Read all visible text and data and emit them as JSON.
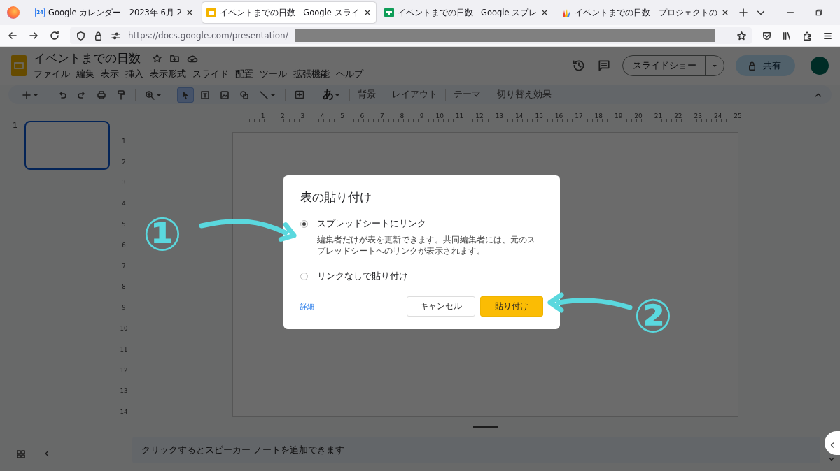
{
  "browser": {
    "tabs": [
      {
        "label": "Google カレンダー - 2023年 6月 2",
        "kind": "calendar",
        "icon_text": "24",
        "selected": false
      },
      {
        "label": "イベントまでの日数 - Google スライ",
        "kind": "slides",
        "selected": true
      },
      {
        "label": "イベントまでの日数 - Google スプレ",
        "kind": "sheets",
        "selected": false
      },
      {
        "label": "イベントまでの日数 - プロジェクトの",
        "kind": "project",
        "selected": false
      }
    ],
    "url": "https://docs.google.com/presentation/"
  },
  "document": {
    "title": "イベントまでの日数",
    "menu": [
      "ファイル",
      "編集",
      "表示",
      "挿入",
      "表示形式",
      "スライド",
      "配置",
      "ツール",
      "拡張機能",
      "ヘルプ"
    ],
    "slideshow_label": "スライドショー",
    "share_label": "共有"
  },
  "toolbar": {
    "tools": [
      {
        "kind": "add",
        "selected": false
      },
      {
        "kind": "undo",
        "selected": false
      },
      {
        "kind": "redo",
        "selected": false
      },
      {
        "kind": "print",
        "selected": false
      },
      {
        "kind": "paint",
        "selected": false
      },
      {
        "kind": "zoom",
        "selected": false
      },
      {
        "kind": "select",
        "selected": true
      },
      {
        "kind": "textbox",
        "selected": false
      },
      {
        "kind": "image",
        "selected": false
      },
      {
        "kind": "shape",
        "selected": false
      },
      {
        "kind": "line",
        "selected": false
      },
      {
        "kind": "comment",
        "selected": false
      }
    ],
    "font_glyph": "あ",
    "text_buttons": [
      "背景",
      "レイアウト",
      "テーマ",
      "切り替え効果"
    ]
  },
  "filmstrip": {
    "slides": [
      {
        "number": "1",
        "selected": true
      }
    ]
  },
  "rulers": {
    "horizontal": [
      "1",
      "2",
      "3",
      "4",
      "5",
      "6",
      "7",
      "8",
      "9",
      "10",
      "11",
      "12",
      "13",
      "14",
      "15",
      "16",
      "17",
      "18",
      "19",
      "20",
      "21",
      "22",
      "23",
      "24",
      "25"
    ],
    "vertical": [
      "1",
      "2",
      "3",
      "4",
      "5",
      "6",
      "7",
      "8",
      "9",
      "10",
      "11",
      "12",
      "13",
      "14"
    ]
  },
  "notes": {
    "placeholder": "クリックするとスピーカー ノートを追加できます"
  },
  "dialog": {
    "title": "表の貼り付け",
    "options": [
      {
        "label": "スプレッドシートにリンク",
        "description": "編集者だけが表を更新できます。共同編集者には、元のスプレッドシートへのリンクが表示されます。",
        "selected": true
      },
      {
        "label": "リンクなしで貼り付け",
        "selected": false
      }
    ],
    "link": "詳細",
    "buttons": [
      {
        "label": "キャンセル",
        "kind": "secondary"
      },
      {
        "label": "貼り付け",
        "kind": "primary"
      }
    ]
  },
  "annotations": [
    {
      "label": "①"
    },
    {
      "label": "②"
    }
  ]
}
